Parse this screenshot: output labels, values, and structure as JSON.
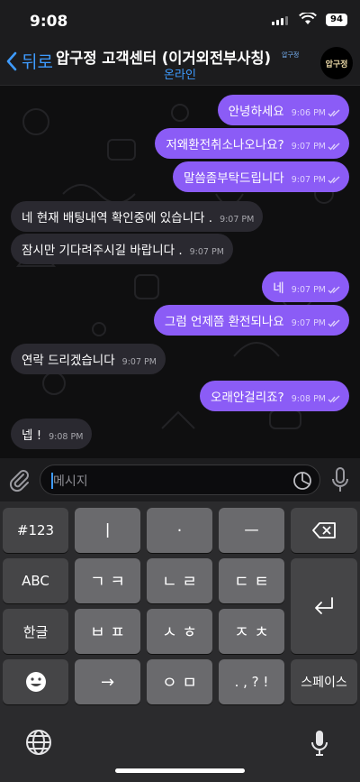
{
  "status": {
    "time": "9:08",
    "battery": "94"
  },
  "header": {
    "back_label": "뒤로",
    "title": "압구정 고객센터 (이거외전부사칭)",
    "tag": "압구정",
    "subtitle": "온라인",
    "avatar_text": "압구정"
  },
  "messages": [
    {
      "dir": "out",
      "text": "안녕하세요",
      "time": "9:06 PM"
    },
    {
      "dir": "out",
      "text": "저왜환전취소나오나요?",
      "time": "9:07 PM"
    },
    {
      "dir": "out",
      "text": "말씀좀부탁드립니다",
      "time": "9:07 PM"
    },
    {
      "dir": "in",
      "text": "네 현재 배팅내역 확인중에 있습니다 .",
      "time": "9:07 PM"
    },
    {
      "dir": "in",
      "text": "잠시만 기다려주시길 바랍니다 .",
      "time": "9:07 PM"
    },
    {
      "dir": "out",
      "text": "네",
      "time": "9:07 PM"
    },
    {
      "dir": "out",
      "text": "그럼 언제쯤 환전되나요",
      "time": "9:07 PM"
    },
    {
      "dir": "in",
      "text": "연락 드리겠습니다",
      "time": "9:07 PM"
    },
    {
      "dir": "out",
      "text": "오래안걸리죠?",
      "time": "9:08 PM"
    },
    {
      "dir": "in",
      "text": "넵 !",
      "time": "9:08 PM"
    }
  ],
  "input": {
    "placeholder": "메시지"
  },
  "keyboard": {
    "row1": [
      "#123",
      "ㅣ",
      "·",
      "ㅡ"
    ],
    "row2": [
      "ABC",
      "ㄱ ㅋ",
      "ㄴ ㄹ",
      "ㄷ ㅌ"
    ],
    "row3": [
      "한글",
      "ㅂ ㅍ",
      "ㅅ ㅎ",
      "ㅈ ㅊ"
    ],
    "row4": [
      "→",
      "ㅇ ㅁ",
      ". , ? !",
      "스페이스"
    ]
  },
  "colors": {
    "outgoing": "#8b5cf6",
    "incoming": "#2a2930",
    "accent": "#3e9bff"
  }
}
